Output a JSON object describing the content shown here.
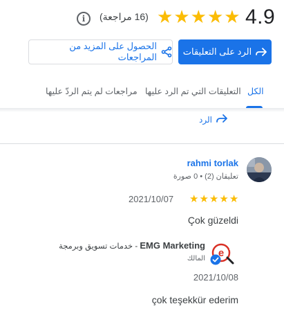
{
  "rating": {
    "value": "4.9",
    "stars": "★★★★★",
    "count_label": "(16 مراجعة)",
    "info_icon": "info-icon"
  },
  "buttons": {
    "reply_label": "الرد على التعليقات",
    "reply_icon": "reply-arrow-icon",
    "share_label": "الحصول على المزيد من المراجعات",
    "share_icon": "share-icon"
  },
  "tabs": [
    {
      "label": "الكل",
      "active": true
    },
    {
      "label": "التعليقات التي تم الرد عليها",
      "active": false
    },
    {
      "label": "مراجعات لم يتم الردّ عليها",
      "active": false
    }
  ],
  "reply_link": {
    "label": "الرد",
    "icon": "reply-arrow-icon"
  },
  "review": {
    "reviewer_name": "rahmi torlak",
    "reviewer_meta": "تعليقان (2) • 0 صورة",
    "stars": "★★★★★",
    "date": "2021/10/07",
    "text": "Çok güzeldi"
  },
  "owner_reply": {
    "business_name": "EMG Marketing",
    "business_desc": " - خدمات تسويق وبرمجة",
    "role_label": "المالك",
    "date": "2021/10/08",
    "text": "çok teşekkür ederim"
  },
  "colors": {
    "accent": "#1a73e8",
    "star": "#fbbc04",
    "text": "#3c4043",
    "muted": "#5f6368",
    "divider": "#dadce0"
  }
}
